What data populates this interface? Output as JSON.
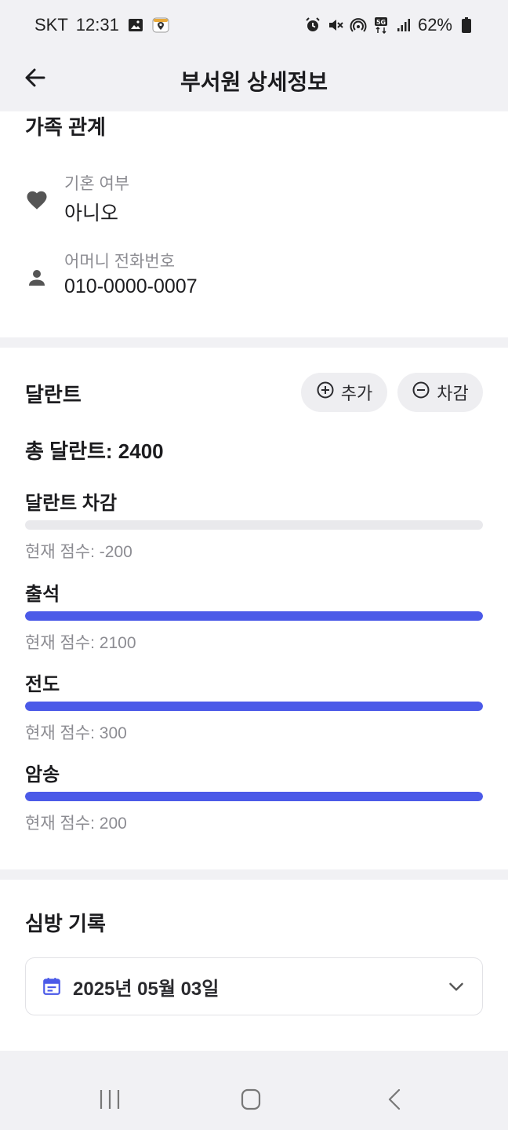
{
  "status_bar": {
    "carrier": "SKT",
    "time": "12:31",
    "battery": "62%",
    "icons": [
      "image-icon",
      "location-app-icon",
      "alarm-icon",
      "mute-icon",
      "hotspot-icon",
      "5g-icon",
      "signal-icon",
      "battery-icon"
    ]
  },
  "appbar": {
    "title": "부서원 상세정보",
    "back_icon": "arrow-left-icon"
  },
  "family": {
    "title": "가족 관계",
    "married_label": "기혼 여부",
    "married_value": "아니오",
    "mother_phone_label": "어머니 전화번호",
    "mother_phone_value": "010-0000-0007"
  },
  "talent": {
    "title": "달란트",
    "add_label": "추가",
    "deduct_label": "차감",
    "total_text": "총 달란트: 2400",
    "categories": [
      {
        "name": "달란트 차감",
        "score_text": "현재 점수: -200",
        "progress": 0
      },
      {
        "name": "출석",
        "score_text": "현재 점수: 2100",
        "progress": 1
      },
      {
        "name": "전도",
        "score_text": "현재 점수: 300",
        "progress": 1
      },
      {
        "name": "암송",
        "score_text": "현재 점수: 200",
        "progress": 1
      }
    ]
  },
  "visit": {
    "title": "심방 기록",
    "selected_date": "2025년 05월 03일"
  },
  "colors": {
    "accent": "#4b5ae8",
    "background": "#f1f1f4",
    "card": "#ffffff"
  }
}
